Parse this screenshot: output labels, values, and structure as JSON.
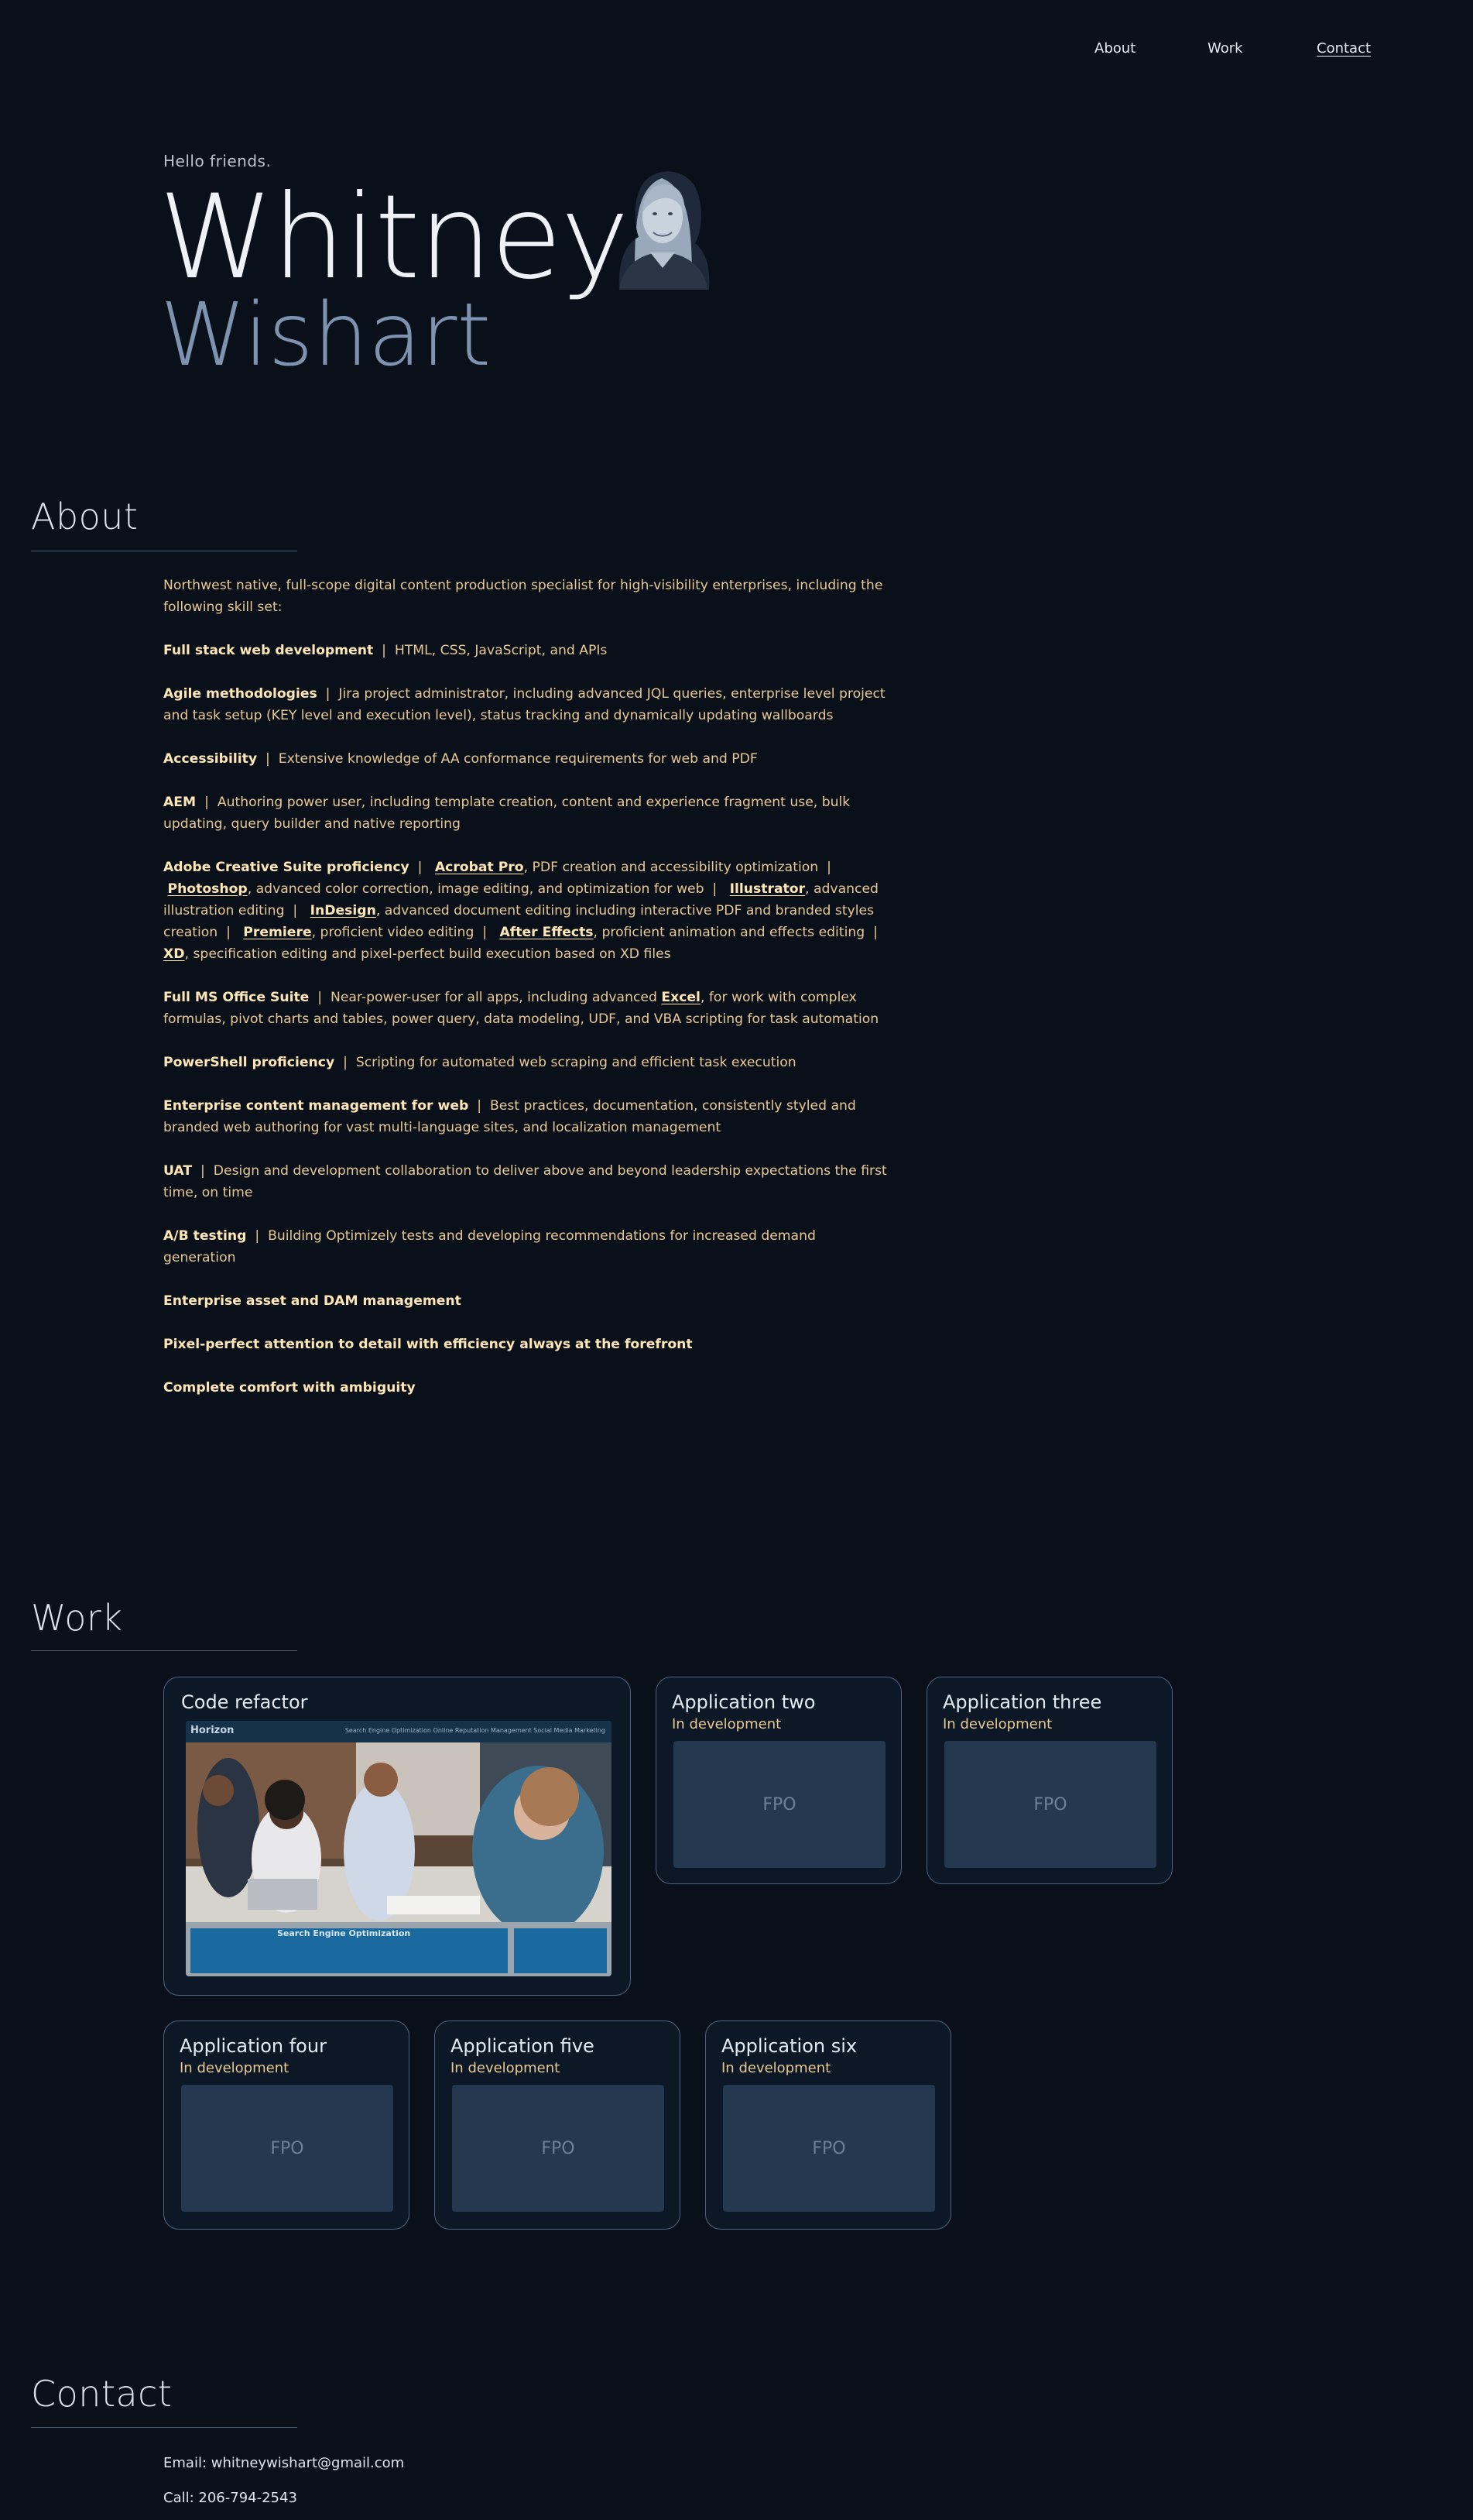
{
  "nav": {
    "about": "About",
    "work": "Work",
    "contact": "Contact"
  },
  "hero": {
    "greeting": "Hello friends.",
    "first_name": "Whitney",
    "last_name": "Wishart"
  },
  "about": {
    "title": "About",
    "intro": "Northwest native, full-scope digital content production specialist for high-visibility enterprises, including the following skill set:",
    "skills": {
      "fullstack_label": "Full stack web development",
      "fullstack_desc": "HTML, CSS, JavaScript, and APIs",
      "agile_label": "Agile methodologies",
      "agile_desc": "Jira project administrator, including advanced JQL queries, enterprise level project and task setup (KEY level and execution level), status tracking and dynamically updating wallboards",
      "access_label": "Accessibility",
      "access_desc": "Extensive knowledge of AA conformance requirements for web and PDF",
      "aem_label": "AEM",
      "aem_desc": "Authoring power user, including template creation, content and experience fragment use, bulk updating, query builder and native reporting",
      "adobe_label": "Adobe Creative Suite proficiency",
      "acrobat": "Acrobat Pro",
      "acrobat_desc": ", PDF creation and accessibility optimization",
      "photoshop": "Photoshop",
      "photoshop_desc": ", advanced color correction, image editing, and optimization for web",
      "illustrator": "Illustrator",
      "illustrator_desc": ", advanced illustration editing",
      "indesign": "InDesign",
      "indesign_desc": ", advanced document editing including interactive PDF and branded styles creation",
      "premiere": "Premiere",
      "premiere_desc": ", proficient video editing",
      "aftereffects": "After Effects",
      "aftereffects_desc": ", proficient animation and effects editing",
      "xd": "XD",
      "xd_desc": ", specification editing and pixel-perfect build execution based on XD files",
      "office_label": "Full MS Office Suite",
      "office_desc_a": "Near-power-user for all apps, including advanced ",
      "excel": "Excel",
      "office_desc_b": ", for work with complex formulas, pivot charts and tables, power query, data modeling, UDF, and VBA scripting for task automation",
      "ps_label": "PowerShell proficiency",
      "ps_desc": "Scripting for automated web scraping and efficient task execution",
      "ecm_label": "Enterprise content management for web",
      "ecm_desc": "Best practices, documentation, consistently styled and branded web authoring for vast multi-language sites, and localization management",
      "uat_label": "UAT",
      "uat_desc": "Design and development collaboration to deliver above and beyond leadership expectations the first time, on time",
      "ab_label": "A/B testing",
      "ab_desc": "Building Optimizely tests and developing recommendations for increased demand generation",
      "dam": "Enterprise asset and DAM management",
      "pixel": "Pixel-perfect attention to detail with efficiency always at the forefront",
      "ambiguity": "Complete comfort with ambiguity"
    }
  },
  "work": {
    "title": "Work",
    "featured": {
      "title": "Code refactor",
      "shot_logo": "Horizon",
      "shot_links": "Search Engine Optimization   Online Reputation Management   Social Media Marketing",
      "shot_heading": "Search Engine Optimization"
    },
    "cards": [
      {
        "title": "Application two",
        "status": "In development",
        "placeholder": "FPO"
      },
      {
        "title": "Application three",
        "status": "In development",
        "placeholder": "FPO"
      },
      {
        "title": "Application four",
        "status": "In development",
        "placeholder": "FPO"
      },
      {
        "title": "Application five",
        "status": "In development",
        "placeholder": "FPO"
      },
      {
        "title": "Application six",
        "status": "In development",
        "placeholder": "FPO"
      }
    ]
  },
  "contact": {
    "title": "Contact",
    "email": "Email: whitneywishart@gmail.com",
    "phone": "Call: 206-794-2543"
  }
}
